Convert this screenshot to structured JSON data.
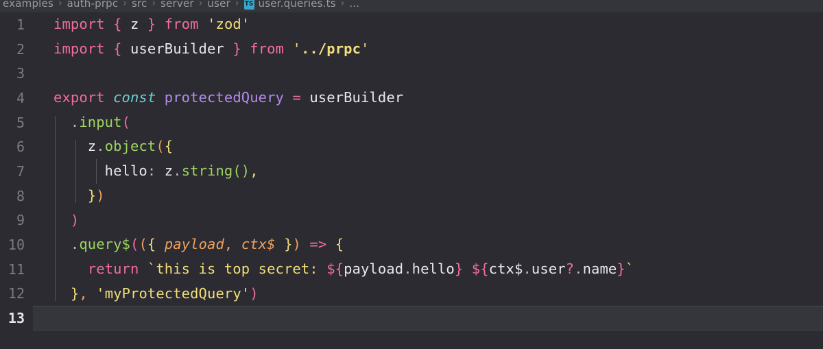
{
  "breadcrumb": {
    "separator": "›",
    "file_icon_label": "TS",
    "items": [
      {
        "label": "examples"
      },
      {
        "label": "auth-prpc"
      },
      {
        "label": "src"
      },
      {
        "label": "server"
      },
      {
        "label": "user"
      },
      {
        "label": "user.queries.ts"
      },
      {
        "label": "..."
      }
    ]
  },
  "editor": {
    "language": "typescript",
    "active_line": 13,
    "background": "#2b2b31",
    "active_line_background": "#35353c",
    "gutter_color": "#7b7b85",
    "active_gutter_color": "#e6e6ea",
    "lines": [
      {
        "number": "1",
        "text": "import { z } from 'zod'"
      },
      {
        "number": "2",
        "text": "import { userBuilder } from '../prpc'"
      },
      {
        "number": "3",
        "text": ""
      },
      {
        "number": "4",
        "text": "export const protectedQuery = userBuilder"
      },
      {
        "number": "5",
        "text": "  .input("
      },
      {
        "number": "6",
        "text": "    z.object({"
      },
      {
        "number": "7",
        "text": "      hello: z.string(),"
      },
      {
        "number": "8",
        "text": "    })"
      },
      {
        "number": "9",
        "text": "  )"
      },
      {
        "number": "10",
        "text": "  .query$(({ payload, ctx$ }) => {"
      },
      {
        "number": "11",
        "text": "    return `this is top secret: ${payload.hello} ${ctx$.user?.name}`"
      },
      {
        "number": "12",
        "text": "  }, 'myProtectedQuery')"
      },
      {
        "number": "13",
        "text": ""
      }
    ]
  },
  "syntax_colors": {
    "keyword": "#f26d9a",
    "keyword_italic": "#6ad2d2",
    "identifier": "#e8e8ec",
    "function": "#9ed45f",
    "declaration": "#b78af0",
    "string": "#f2de7a",
    "parameter": "#f0a15e",
    "bracket_level_1": "#f26d9a",
    "bracket_level_2": "#f0a15e",
    "bracket_level_3": "#f2de7a",
    "bracket_level_4": "#9ed45f"
  }
}
